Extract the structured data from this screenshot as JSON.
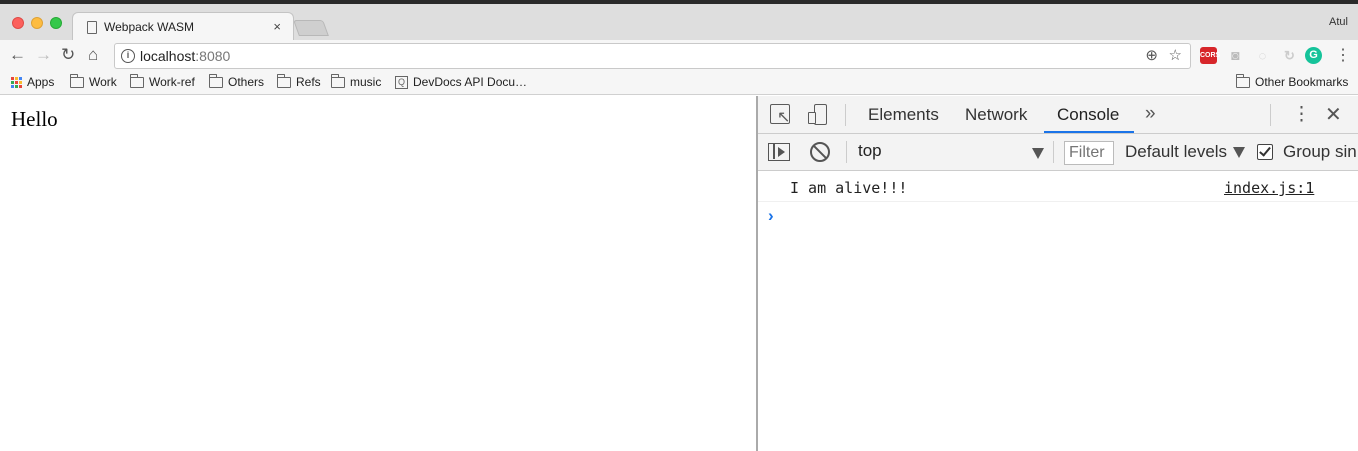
{
  "browser": {
    "tab": {
      "title": "Webpack WASM",
      "close": "×"
    },
    "profile": "Atul",
    "nav": {
      "back": "←",
      "forward": "→",
      "reload": "↻",
      "home": "⌂"
    },
    "omnibox": {
      "info": "i",
      "host": "localhost",
      "port": ":8080",
      "zoom": "⊕",
      "star": "☆"
    },
    "extensions": {
      "cors": "CORS",
      "camera": "◙",
      "g": "G",
      "kebab": "⋮"
    },
    "bookmarks": [
      "Apps",
      "Work",
      "Work-ref",
      "Others",
      "Refs",
      "music",
      "DevDocs API Docu…"
    ],
    "other_bookmarks": "Other Bookmarks",
    "devdocs_icon": "Q"
  },
  "page": {
    "text": "Hello"
  },
  "devtools": {
    "tabs": [
      "Elements",
      "Network",
      "Console"
    ],
    "more": "»",
    "kebab": "⋮",
    "close": "✕",
    "context": "top",
    "filter_placeholder": "Filter",
    "levels": "Default levels",
    "group_label": "Group sin",
    "log": {
      "message": "I am alive!!!",
      "source": "index.js:1"
    },
    "prompt": "›"
  },
  "colors": {
    "accent": "#1a73e8",
    "cors": "#d7262a",
    "grammarly": "#15c39a"
  }
}
